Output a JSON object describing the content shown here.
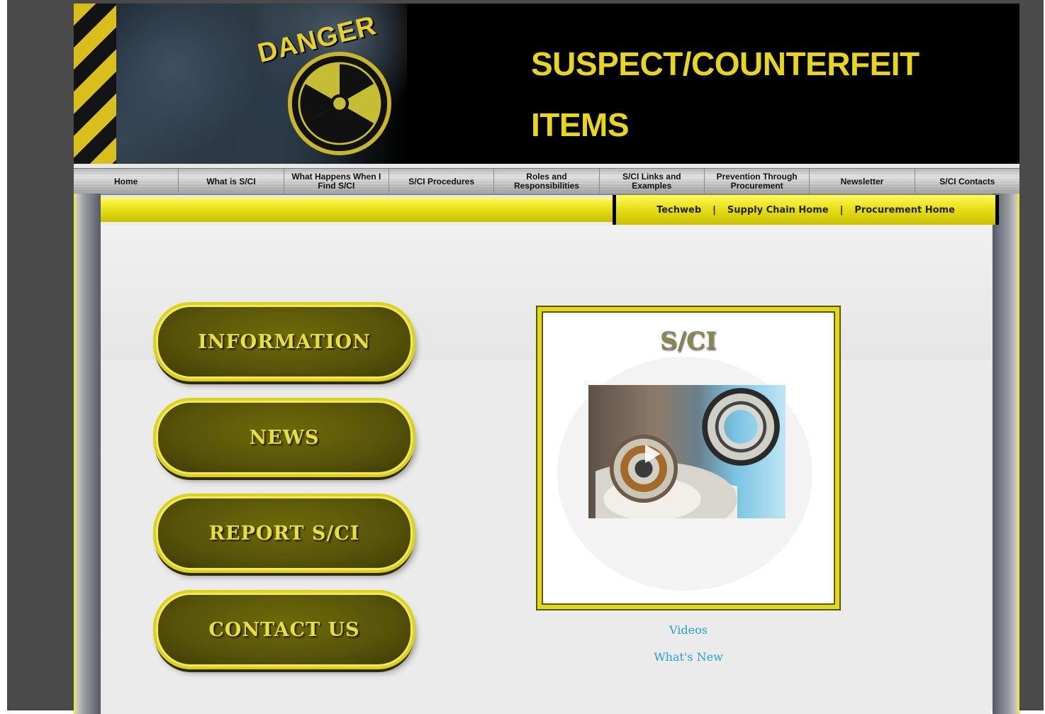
{
  "banner": {
    "danger_label": "DANGER",
    "title_line1": "SUSPECT/COUNTERFEIT",
    "title_line2": "ITEMS"
  },
  "nav": {
    "items": [
      {
        "label": "Home"
      },
      {
        "label": "What is S/CI"
      },
      {
        "label": "What Happens When I Find S/CI"
      },
      {
        "label": "S/CI Procedures"
      },
      {
        "label": "Roles and Responsibilities"
      },
      {
        "label": "S/CI Links and Examples"
      },
      {
        "label": "Prevention Through Procurement"
      },
      {
        "label": "Newsletter"
      },
      {
        "label": "S/CI Contacts"
      }
    ]
  },
  "sub_links": {
    "techweb": "Techweb",
    "supply_chain": "Supply Chain Home",
    "procurement": "Procurement Home",
    "separator": "|"
  },
  "buttons": {
    "information": "INFORMATION",
    "news": "NEWS",
    "report": "REPORT S/CI",
    "contact": "CONTACT US"
  },
  "media": {
    "title": "S/CI",
    "video_icon": "play-icon"
  },
  "links": {
    "videos": "Videos",
    "whats_new": "What's New"
  },
  "colors": {
    "accent_yellow": "#e8e01a",
    "button_olive": "#57530a",
    "link_blue": "#2aa0cf",
    "page_bg": "#4a4a4a"
  }
}
